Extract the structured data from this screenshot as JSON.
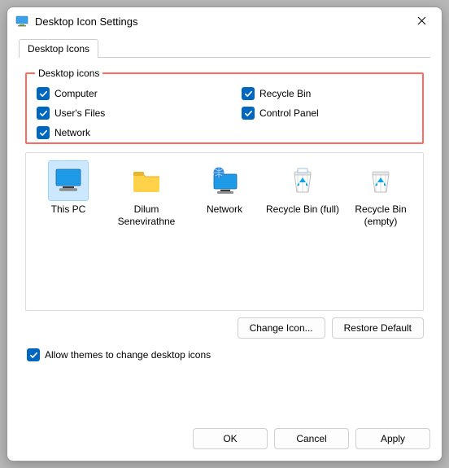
{
  "window": {
    "title": "Desktop Icon Settings"
  },
  "tab": {
    "label": "Desktop Icons"
  },
  "groupbox": {
    "legend": "Desktop icons",
    "items": {
      "computer": {
        "label": "Computer"
      },
      "recycle": {
        "label": "Recycle Bin"
      },
      "userfiles": {
        "label": "User's Files"
      },
      "cpanel": {
        "label": "Control Panel"
      },
      "network": {
        "label": "Network"
      }
    }
  },
  "preview": {
    "thispc": {
      "label": "This PC"
    },
    "userfolder": {
      "label": "Dilum Senevirathne"
    },
    "network": {
      "label": "Network"
    },
    "binfull": {
      "label": "Recycle Bin (full)"
    },
    "binempty": {
      "label": "Recycle Bin (empty)"
    }
  },
  "buttons": {
    "change_icon": "Change Icon...",
    "restore_default": "Restore Default",
    "ok": "OK",
    "cancel": "Cancel",
    "apply": "Apply"
  },
  "allow_themes": {
    "label": "Allow themes to change desktop icons"
  }
}
